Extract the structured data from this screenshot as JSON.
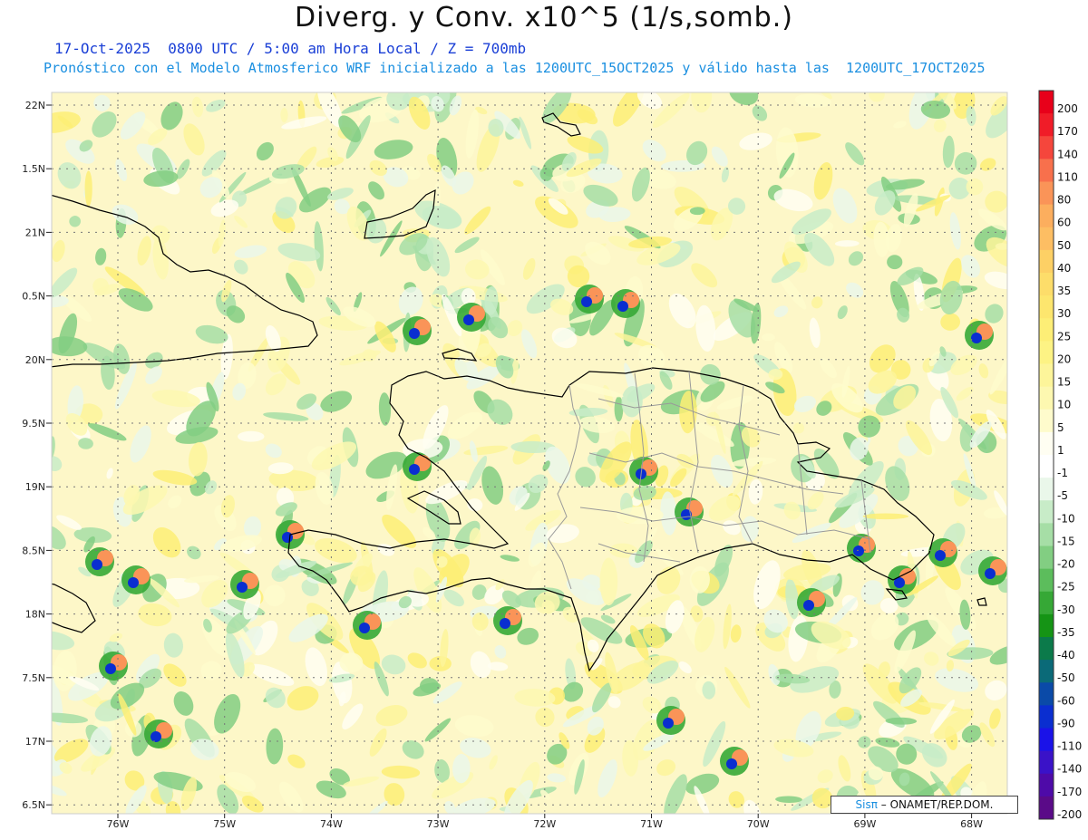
{
  "header": {
    "title": "Diverg. y Conv. x10^5 (1/s,somb.)",
    "subtitle_time": "17-Oct-2025  0800 UTC / 5:00 am Hora Local / Z = 700mb",
    "subtitle_model": "Pronóstico con el Modelo Atmosferico WRF inicializado a las 1200UTC_15OCT2025 y válido hasta las  1200UTC_17OCT2025"
  },
  "map": {
    "lat_labels": [
      "22N",
      "1.5N",
      "21N",
      "0.5N",
      "20N",
      "9.5N",
      "19N",
      "8.5N",
      "18N",
      "7.5N",
      "17N",
      "6.5N"
    ],
    "lon_labels": [
      "76W",
      "75W",
      "74W",
      "73W",
      "72W",
      "71W",
      "70W",
      "69W",
      "68W"
    ],
    "lat_range": [
      16.5,
      22.0
    ],
    "lon_range": [
      -76.6,
      -67.6
    ],
    "grid": true
  },
  "colorbar": {
    "labels": [
      "200",
      "170",
      "140",
      "110",
      "80",
      "60",
      "50",
      "40",
      "35",
      "30",
      "25",
      "20",
      "15",
      "10",
      "5",
      "1",
      "-1",
      "-5",
      "-10",
      "-15",
      "-20",
      "-25",
      "-30",
      "-35",
      "-40",
      "-50",
      "-60",
      "-90",
      "-110",
      "-140",
      "-170",
      "-200"
    ],
    "colors": [
      "#e8001a",
      "#f01c28",
      "#f5463c",
      "#f8704c",
      "#fa9458",
      "#fcae5e",
      "#fdbe63",
      "#fdd065",
      "#fddd6a",
      "#fde66e",
      "#fdee76",
      "#fdf384",
      "#fdf59a",
      "#fdf8b0",
      "#fefbcc",
      "#fffef2",
      "#ffffff",
      "#eaf7ea",
      "#c8ecc8",
      "#a6dea6",
      "#82ce82",
      "#5cbd5c",
      "#36a836",
      "#159415",
      "#0b7a4a",
      "#0a6a78",
      "#0a4aa8",
      "#0a2ed0",
      "#1a12e8",
      "#3a12c8",
      "#4e0aa8",
      "#5a0a88"
    ]
  },
  "credit": {
    "brand": "Sisπ",
    "text": " – ONAMET/REP.DOM."
  }
}
